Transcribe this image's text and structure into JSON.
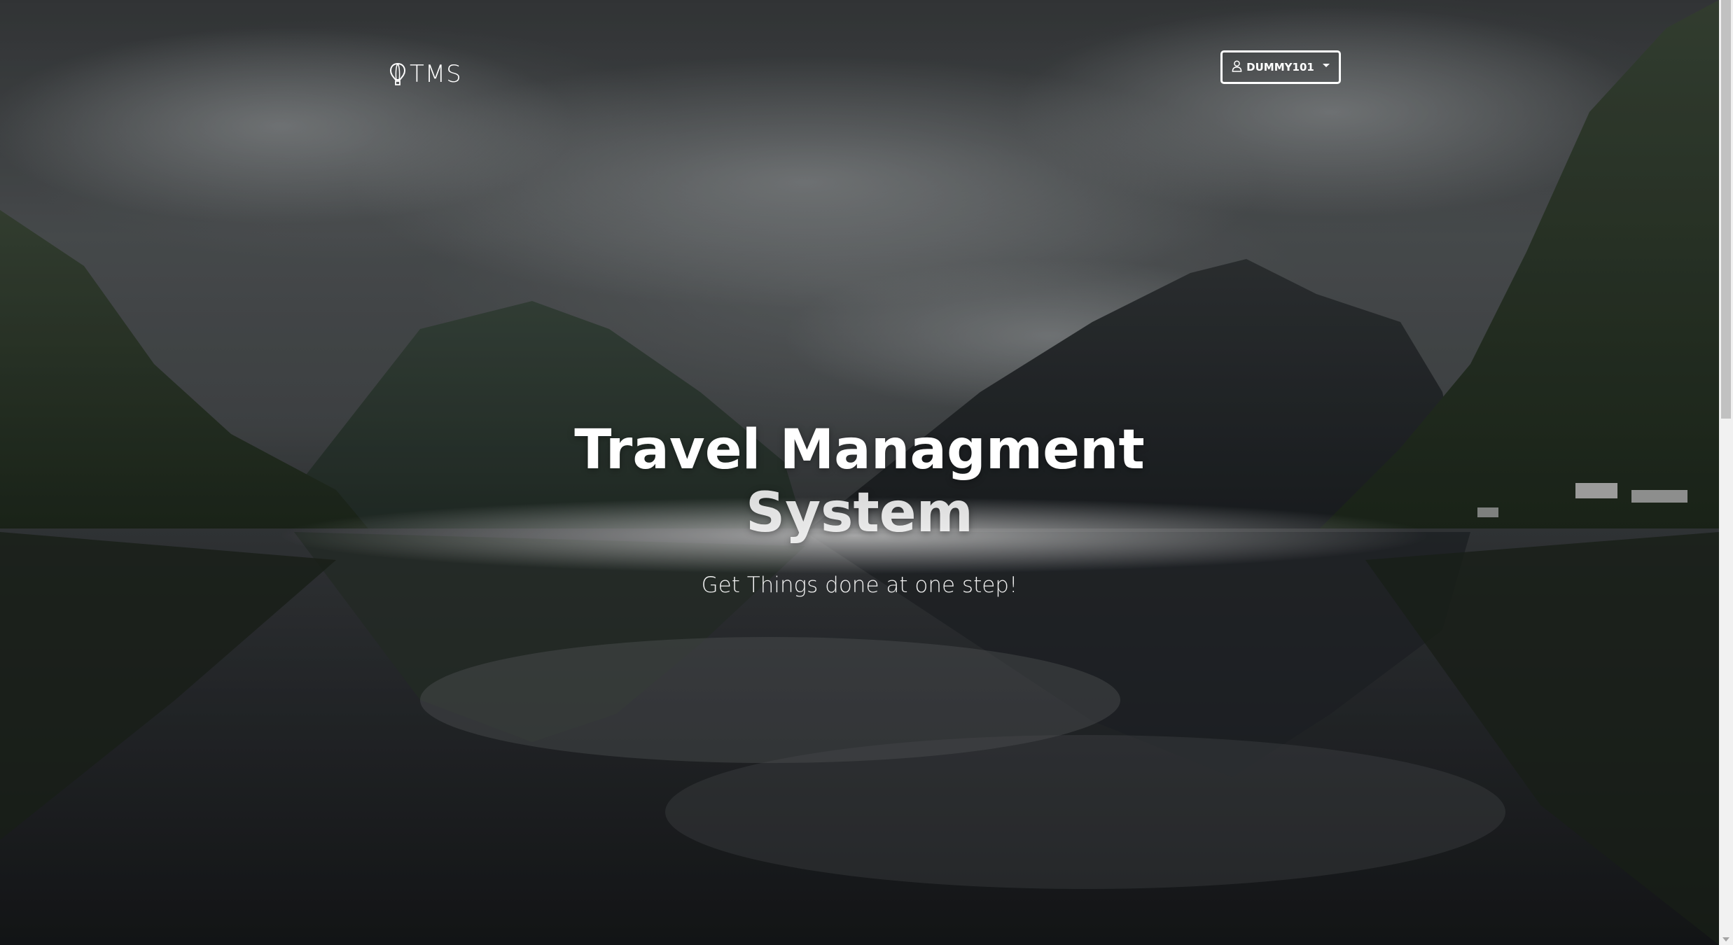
{
  "brand": {
    "name": "TMS",
    "icon": "hot-air-balloon-icon"
  },
  "user_menu": {
    "label": "DUMMY101",
    "icon": "user-icon"
  },
  "hero": {
    "title_line1": "Travel Managment",
    "title_line2": "System",
    "subtitle": "Get Things done at one step!"
  },
  "colors": {
    "text": "#ffffff",
    "scrollbar_track": "#f1f1f1",
    "scrollbar_thumb": "#c1c1c1"
  }
}
